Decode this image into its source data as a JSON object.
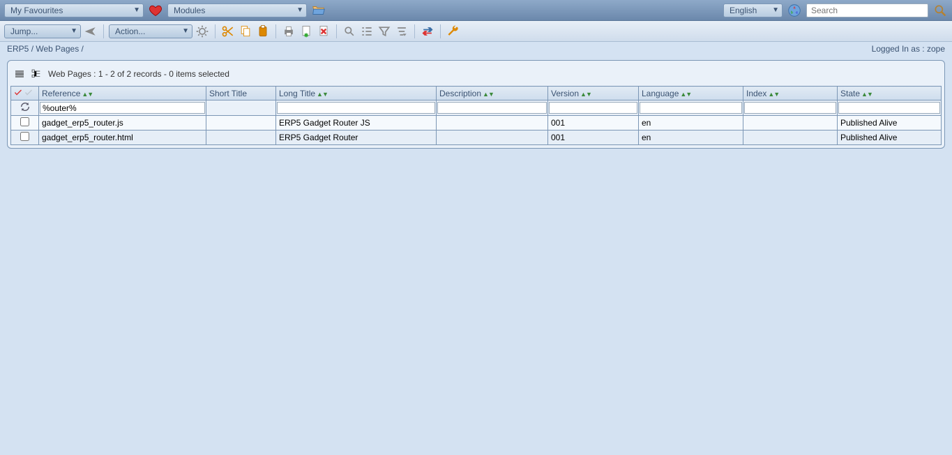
{
  "topbar": {
    "favourites": "My Favourites",
    "modules": "Modules",
    "language": "English",
    "search_placeholder": "Search"
  },
  "toolbar": {
    "jump": "Jump...",
    "action": "Action..."
  },
  "breadcrumb": {
    "root": "ERP5",
    "module": "Web Pages",
    "sep": " / ",
    "logged_in_label": "Logged In as :",
    "user": "zope"
  },
  "listbox": {
    "title": "Web Pages :  1 - 2 of 2 records - 0 items selected",
    "columns": {
      "reference": "Reference",
      "short_title": "Short Title",
      "long_title": "Long Title",
      "description": "Description",
      "version": "Version",
      "language": "Language",
      "index": "Index",
      "state": "State"
    },
    "filter": {
      "reference": "%outer%",
      "short_title": "",
      "long_title": "",
      "description": "",
      "version": "",
      "language": "",
      "index": "",
      "state": ""
    },
    "rows": [
      {
        "reference": "gadget_erp5_router.js",
        "short_title": "",
        "long_title": "ERP5 Gadget Router JS",
        "description": "",
        "version": "001",
        "language": "en",
        "index": "",
        "state": "Published Alive"
      },
      {
        "reference": "gadget_erp5_router.html",
        "short_title": "",
        "long_title": "ERP5 Gadget Router",
        "description": "",
        "version": "001",
        "language": "en",
        "index": "",
        "state": "Published Alive"
      }
    ]
  }
}
